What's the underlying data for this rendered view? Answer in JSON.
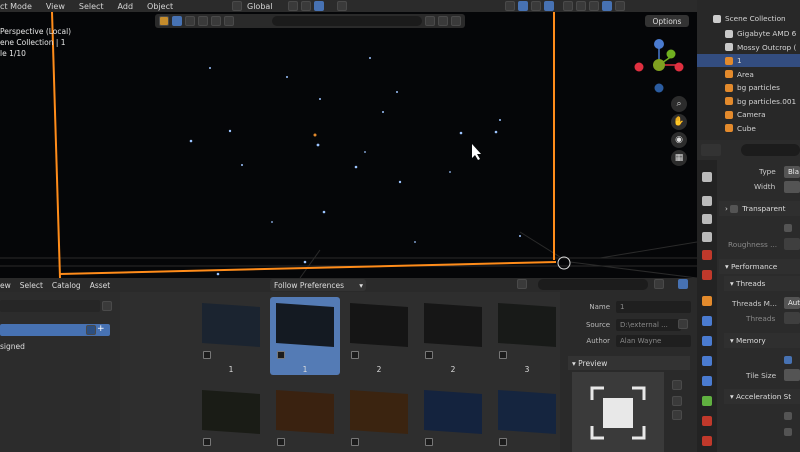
{
  "menu": {
    "mode": "ct Mode",
    "items": [
      "View",
      "Select",
      "Add",
      "Object"
    ],
    "transform": "Global"
  },
  "viewport": {
    "hud": [
      "Perspective (Local)",
      "ene Collection | 1",
      "le 1/10"
    ],
    "options_label": "Options"
  },
  "asset_browser": {
    "menu": [
      "ew",
      "Select",
      "Catalog",
      "Asset"
    ],
    "import_method": "Follow Preferences",
    "catalog_item": "signed",
    "thumbnails": [
      {
        "label": "1",
        "selected": false,
        "tone": "#1b2430"
      },
      {
        "label": "1",
        "selected": true,
        "tone": "#141a22"
      },
      {
        "label": "2",
        "selected": false,
        "tone": "#151515"
      },
      {
        "label": "2",
        "selected": false,
        "tone": "#161616"
      },
      {
        "label": "3",
        "selected": false,
        "tone": "#181a18"
      },
      {
        "label": "",
        "selected": false,
        "tone": "#1a1c16"
      },
      {
        "label": "",
        "selected": false,
        "tone": "#3a2210"
      },
      {
        "label": "",
        "selected": false,
        "tone": "#3b2410"
      },
      {
        "label": "",
        "selected": false,
        "tone": "#14233e"
      },
      {
        "label": "",
        "selected": false,
        "tone": "#15253f"
      }
    ],
    "properties": {
      "name_label": "Name",
      "name_value": "1",
      "source_label": "Source",
      "source_value": "D:\\external ...",
      "author_label": "Author",
      "author_value": "Alan Wayne",
      "preview_label": "Preview"
    }
  },
  "outliner": {
    "title": "Scene Collection",
    "rows": [
      {
        "label": "Gigabyte AMD 6",
        "color": "#c9c9c9",
        "selected": false
      },
      {
        "label": "Mossy Outcrop (",
        "color": "#c9c9c9",
        "selected": false
      },
      {
        "label": "1",
        "color": "#e38a2c",
        "selected": true
      },
      {
        "label": "Area",
        "color": "#e38a2c",
        "selected": false
      },
      {
        "label": "bg particles",
        "color": "#e38a2c",
        "selected": false
      },
      {
        "label": "bg particles.001",
        "color": "#e38a2c",
        "selected": false
      },
      {
        "label": "Camera",
        "color": "#e38a2c",
        "selected": false
      },
      {
        "label": "Cube",
        "color": "#e38a2c",
        "selected": false
      }
    ]
  },
  "properties": {
    "type_label": "Type",
    "type_value": "Bla",
    "width_label": "Width",
    "transparent_label": "Transparent",
    "roughness_label": "Roughness ...",
    "performance_label": "Performance",
    "threads_label": "Threads",
    "threads_mode_label": "Threads M...",
    "threads_mode_value": "Auto",
    "threads_sub_label": "Threads",
    "memory_label": "Memory",
    "tile_size_label": "Tile Size",
    "accel_label": "Acceleration St"
  },
  "colors": {
    "accent": "#4772b3",
    "selection_orange": "#ff8c1a",
    "bg_viewport": "#050608"
  }
}
